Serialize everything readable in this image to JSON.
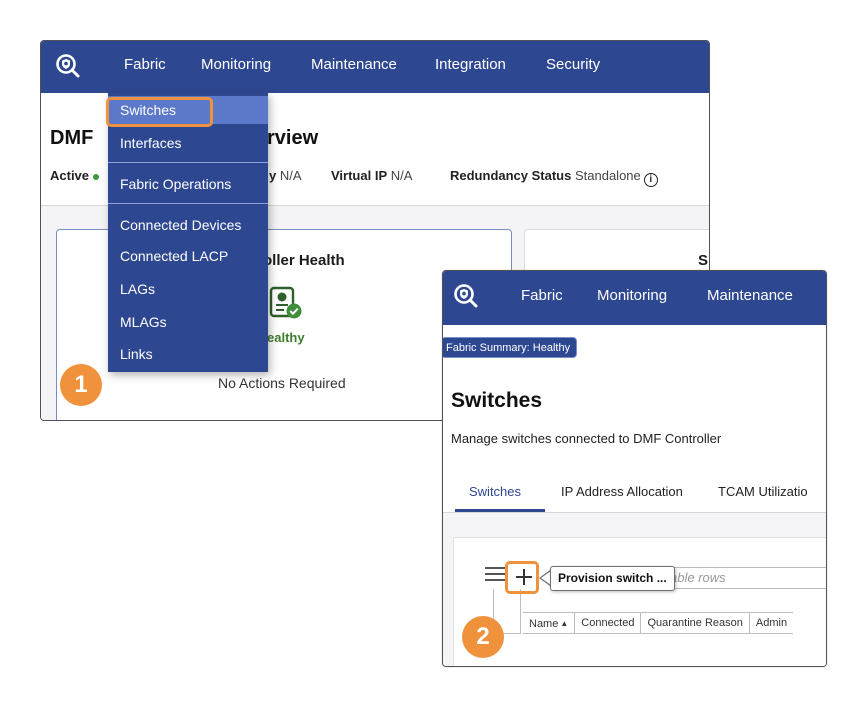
{
  "shot1": {
    "nav": [
      "Fabric",
      "Monitoring",
      "Maintenance",
      "Integration",
      "Security"
    ],
    "page_title_start": "DMF",
    "page_title_end": "rview",
    "status": {
      "active_label": "Active",
      "partial_label": "y",
      "partial_value": "N/A",
      "virtual_ip_label": "Virtual IP",
      "virtual_ip_value": "N/A",
      "redundancy_label": "Redundancy Status",
      "redundancy_value": "Standalone"
    },
    "dropdown": [
      "Switches",
      "Interfaces",
      "Fabric Operations",
      "Connected Devices",
      "Connected LACP",
      "LAGs",
      "MLAGs",
      "Links"
    ],
    "health_card": {
      "title": "oller Health",
      "status": "ealthy",
      "actions": "No Actions Required"
    },
    "right_card_title": "S",
    "badge": "1"
  },
  "shot2": {
    "nav": [
      "Fabric",
      "Monitoring",
      "Maintenance"
    ],
    "summary_pill": "Fabric Summary: Healthy",
    "title": "Switches",
    "subtitle": "Manage switches connected to DMF Controller",
    "tabs": [
      "Switches",
      "IP Address Allocation",
      "TCAM Utilizatio"
    ],
    "filter_placeholder": "able rows",
    "tooltip": "Provision switch ...",
    "table_headers": [
      "Name",
      "Connected",
      "Quarantine Reason",
      "Admin"
    ],
    "badge": "2"
  },
  "colors": {
    "navbar": "#2e4791",
    "menu_active": "#5b78c9",
    "highlight": "#f0923c",
    "healthy": "#3f7d2e"
  },
  "icons": [
    "logo-icon",
    "info-icon",
    "health-status-icon",
    "menu-icon",
    "plus-icon"
  ]
}
